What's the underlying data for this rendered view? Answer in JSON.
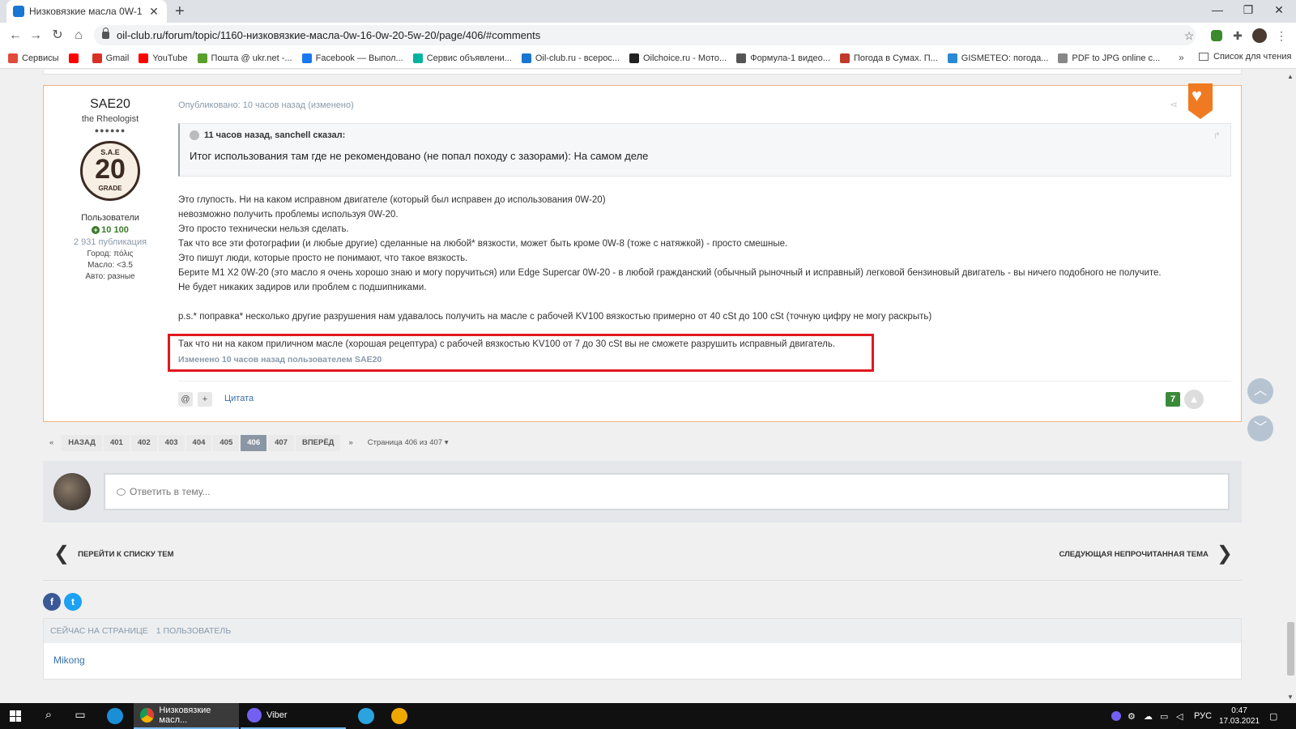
{
  "browser": {
    "tab_title": "Низковязкие масла 0W-16, 0W-",
    "url": "oil-club.ru/forum/topic/1160-низковязкие-масла-0w-16-0w-20-5w-20/page/406/#comments",
    "bookmarks": [
      {
        "label": "Сервисы",
        "color": "#e24a3a"
      },
      {
        "label": "",
        "color": "#ff0000"
      },
      {
        "label": "Gmail",
        "color": "#d93025"
      },
      {
        "label": "YouTube",
        "color": "#ff0000"
      },
      {
        "label": "Пошта @ ukr.net -...",
        "color": "#5aa02c"
      },
      {
        "label": "Facebook — Выпол...",
        "color": "#1877f2"
      },
      {
        "label": "Сервис объявлени...",
        "color": "#00b39f"
      },
      {
        "label": "Oil-club.ru - всерос...",
        "color": "#1976d2"
      },
      {
        "label": "Oilchoice.ru - Мото...",
        "color": "#222222"
      },
      {
        "label": "Формула-1 видео...",
        "color": "#555555"
      },
      {
        "label": "Погода в Сумах. П...",
        "color": "#c0392b"
      },
      {
        "label": "GISMETEO: погода...",
        "color": "#2a8ad6"
      },
      {
        "label": "PDF to JPG online c...",
        "color": "#888888"
      }
    ],
    "bookmarks_more": "»",
    "reading_list": "Список для чтения"
  },
  "post": {
    "author": {
      "name": "SAE20",
      "title": "the Rheologist",
      "rank_dots": "●●●●●●",
      "badge_top": "S.A.E",
      "badge_num": "20",
      "badge_bottom": "GRADE",
      "group": "Пользователи",
      "reputation": "10 100",
      "posts": "2 931 публикация",
      "city": "Город: πόλις",
      "oil": "Масло: <3.5",
      "car": "Авто: разные"
    },
    "meta": "Опубликовано: 10 часов назад (изменено)",
    "quote": {
      "header": "11 часов назад, sanchell сказал:",
      "text": "Итог использования там где не рекомендовано (не попал походу с зазорами): На самом деле"
    },
    "body_lines": [
      "Это глупость. Ни на каком исправном двигателе (который был исправен до использования 0W-20)",
      "невозможно получить проблемы используя 0W-20.",
      "Это просто технически нельзя сделать.",
      "Так что все эти фотографии (и любые другие) сделанные на любой* вязкости, может быть кроме 0W-8 (тоже с натяжкой) - просто смешные.",
      "Это пишут люди, которые просто не понимают, что такое вязкость.",
      "Берите M1 X2 0W-20 (это масло я очень хорошо знаю и могу поручиться) или Edge Supercar 0W-20 - в любой гражданский (обычный рыночный и исправный) легковой бензиновый двигатель - вы ничего подобного не получите.",
      "Не будет никаких задиров или проблем с подшипниками."
    ],
    "ps": "p.s.* поправка* несколько другие разрушения нам удавалось получить на масле с рабочей KV100 вязкостью примерно от 40 cSt до 100 cSt (точную цифру не могу раскрыть)",
    "highlight_text": "Так что ни на каком приличном масле (хорошая рецептура) с рабочей вязкостью KV100 от 7 до 30 cSt вы не сможете разрушить исправный двигатель.",
    "edited": "Изменено 10 часов назад пользователем SAE20",
    "mention_btn": "@",
    "plus_btn": "+",
    "quote_link": "Цитата",
    "rep_count": "7"
  },
  "pager": {
    "first": "«",
    "prev": "НАЗАД",
    "pages": [
      "401",
      "402",
      "403",
      "404",
      "405",
      "406",
      "407"
    ],
    "active_page": "406",
    "next": "ВПЕРЁД",
    "last": "»",
    "info": "Страница 406 из 407 ▾"
  },
  "reply": {
    "placeholder": "Ответить в тему..."
  },
  "topic_nav": {
    "back": "ПЕРЕЙТИ К СПИСКУ ТЕМ",
    "next": "СЛЕДУЮЩАЯ НЕПРОЧИТАННАЯ ТЕМА"
  },
  "social": {
    "fb": "f",
    "tw": "t"
  },
  "online": {
    "label": "СЕЙЧАС НА СТРАНИЦЕ",
    "count": "1 ПОЛЬЗОВАТЕЛЬ",
    "users": [
      "Mikong"
    ]
  },
  "taskbar": {
    "chrome_label": "Низковязкие масл...",
    "viber_label": "Viber",
    "lang": "РУС",
    "time": "0:47",
    "date": "17.03.2021"
  },
  "colors": {
    "accent_orange": "#f07a22",
    "highlight_red": "#e0181f",
    "rep_green": "#3a8a3a"
  }
}
